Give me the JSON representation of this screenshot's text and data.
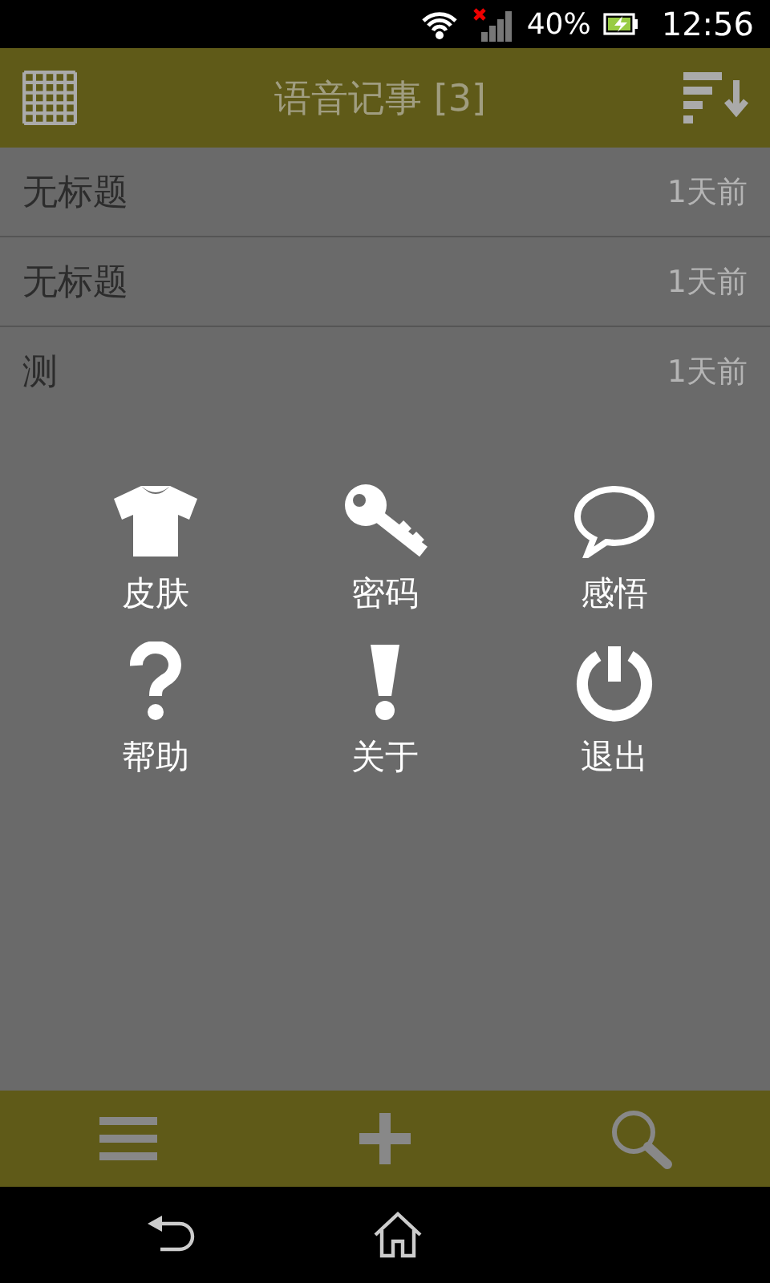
{
  "status_bar": {
    "battery": "40%",
    "time": "12:56"
  },
  "header": {
    "title": "语音记事 [3]"
  },
  "notes": [
    {
      "title": "无标题",
      "time": "1天前"
    },
    {
      "title": "无标题",
      "time": "1天前"
    },
    {
      "title": "测",
      "time": "1天前"
    }
  ],
  "menu": {
    "items": [
      {
        "label": "皮肤",
        "kind": "shirt"
      },
      {
        "label": "密码",
        "kind": "key"
      },
      {
        "label": "感悟",
        "kind": "bubble"
      },
      {
        "label": "帮助",
        "kind": "question"
      },
      {
        "label": "关于",
        "kind": "exclamation"
      },
      {
        "label": "退出",
        "kind": "power"
      }
    ]
  }
}
